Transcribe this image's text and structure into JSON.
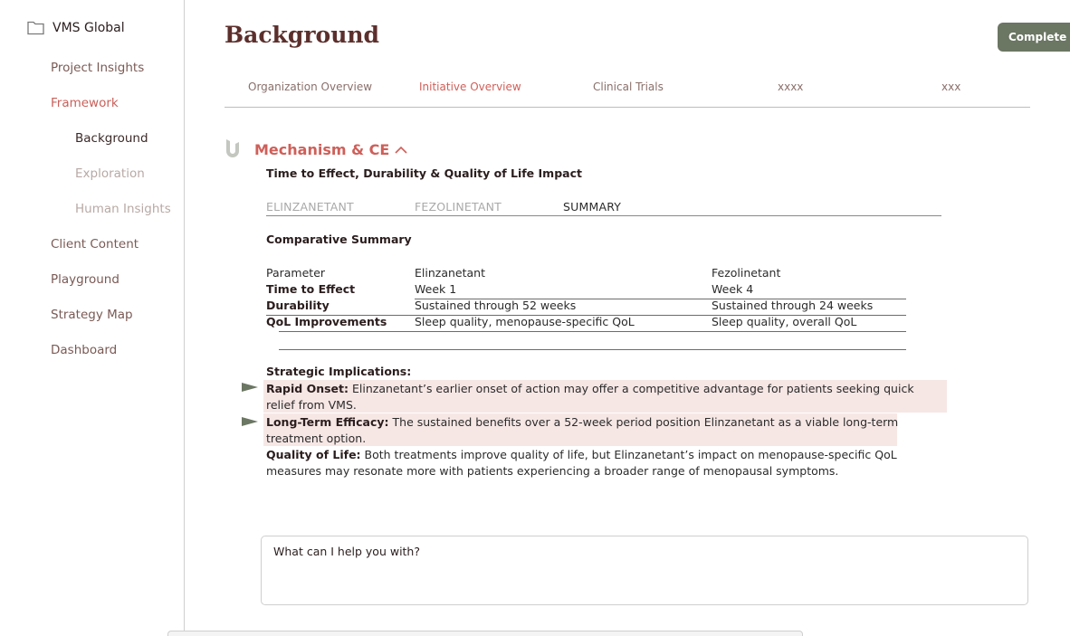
{
  "sidebar": {
    "project": "VMS Global",
    "items": [
      {
        "label": "Project Insights"
      },
      {
        "label": "Framework"
      },
      {
        "label": "Client Content"
      },
      {
        "label": "Playground"
      },
      {
        "label": "Strategy Map"
      },
      {
        "label": "Dashboard"
      }
    ],
    "sub_items": [
      {
        "label": "Background"
      },
      {
        "label": "Exploration"
      },
      {
        "label": "Human Insights"
      }
    ]
  },
  "header": {
    "title": "Background",
    "complete_label": "Complete"
  },
  "tabs": [
    {
      "label": "Organization Overview"
    },
    {
      "label": "Initiative Overview"
    },
    {
      "label": "Clinical Trials"
    },
    {
      "label": "xxxx"
    },
    {
      "label": "xxx"
    }
  ],
  "section": {
    "title": "Mechanism & CE",
    "subtitle": "Time to Effect, Durability & Quality of Life Impact",
    "drug_tabs": [
      "ELINZANETANT",
      "FEZOLINETANT",
      "SUMMARY"
    ],
    "comparative_title": "Comparative Summary",
    "table": {
      "headers": [
        "Parameter",
        "Elinzanetant",
        "Fezolinetant"
      ],
      "rows": [
        [
          "Time to Effect",
          "Week 1",
          "Week 4"
        ],
        [
          "Durability",
          "Sustained through 52 weeks",
          "Sustained through 24 weeks"
        ],
        [
          "QoL Improvements",
          "Sleep quality, menopause-specific QoL",
          "Sleep quality, overall QoL"
        ]
      ]
    },
    "implications_title": "Strategic Implications:",
    "implications": [
      {
        "label": "Rapid Onset:",
        "text": " Elinzanetant’s earlier onset of action may offer a competitive advantage for patients seeking quick relief from VMS."
      },
      {
        "label": "Long-Term Efficacy:",
        "text": " The sustained benefits over a 52-week period position Elinzanetant as a viable long-term treatment option."
      },
      {
        "label": "Quality of Life:",
        "text": " Both treatments improve quality of life, but Elinzanetant’s impact on menopause-specific QoL measures may resonate more with patients experiencing a broader range of menopausal symptoms."
      }
    ]
  },
  "chat": {
    "placeholder": "What can I help you with?"
  },
  "colors": {
    "accent": "#cf5f59",
    "title": "#5c2f2c",
    "button": "#6b7663",
    "highlight": "#f6e7e5"
  }
}
